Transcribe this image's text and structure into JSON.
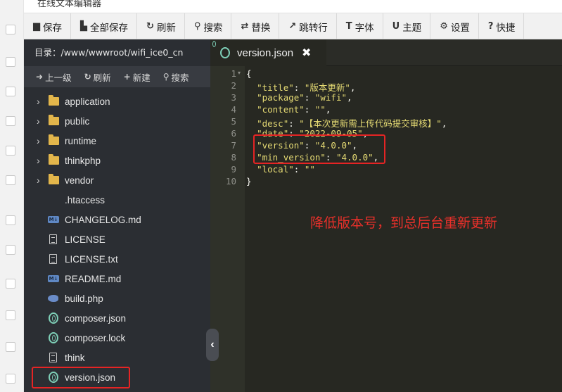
{
  "window": {
    "title": "在线文本编辑器"
  },
  "toolbar": {
    "items": [
      {
        "label": "保存",
        "icon": "save-icon"
      },
      {
        "label": "全部保存",
        "icon": "save-all-icon"
      },
      {
        "label": "刷新",
        "icon": "refresh-icon"
      },
      {
        "label": "搜索",
        "icon": "search-icon"
      },
      {
        "label": "替换",
        "icon": "replace-icon"
      },
      {
        "label": "跳转行",
        "icon": "goto-line-icon"
      },
      {
        "label": "字体",
        "icon": "font-icon"
      },
      {
        "label": "主题",
        "icon": "theme-icon"
      },
      {
        "label": "设置",
        "icon": "gear-icon"
      },
      {
        "label": "快捷",
        "icon": "help-icon"
      }
    ]
  },
  "sidebar": {
    "path_label": "目录：/www/wwwroot/wifi_ice0_cn",
    "tools": [
      {
        "label": "上一级",
        "icon": "up-level-icon"
      },
      {
        "label": "刷新",
        "icon": "refresh-icon"
      },
      {
        "label": "新建",
        "icon": "plus-icon"
      },
      {
        "label": "搜索",
        "icon": "search-icon"
      }
    ],
    "tree": [
      {
        "name": "application",
        "type": "folder"
      },
      {
        "name": "public",
        "type": "folder"
      },
      {
        "name": "runtime",
        "type": "folder"
      },
      {
        "name": "thinkphp",
        "type": "folder"
      },
      {
        "name": "vendor",
        "type": "folder"
      },
      {
        "name": ".htaccess",
        "type": "file"
      },
      {
        "name": "CHANGELOG.md",
        "type": "markdown"
      },
      {
        "name": "LICENSE",
        "type": "text"
      },
      {
        "name": "LICENSE.txt",
        "type": "text"
      },
      {
        "name": "README.md",
        "type": "markdown"
      },
      {
        "name": "build.php",
        "type": "php"
      },
      {
        "name": "composer.json",
        "type": "json"
      },
      {
        "name": "composer.lock",
        "type": "json"
      },
      {
        "name": "think",
        "type": "text"
      },
      {
        "name": "version.json",
        "type": "json",
        "selected": true
      }
    ]
  },
  "editor": {
    "tab": {
      "filename": "version.json",
      "close": "✖"
    },
    "lines": [
      {
        "n": "1",
        "text": "{"
      },
      {
        "n": "2",
        "key": "\"title\"",
        "val": "\"版本更新\"",
        "end": ","
      },
      {
        "n": "3",
        "key": "\"package\"",
        "val": "\"wifi\"",
        "end": ","
      },
      {
        "n": "4",
        "key": "\"content\"",
        "val": "\"\"",
        "end": ","
      },
      {
        "n": "5",
        "key": "\"desc\"",
        "val": "\"【本次更新需上传代码提交审核】\"",
        "end": ","
      },
      {
        "n": "6",
        "key": "\"date\"",
        "val": "\"2022-09-05\"",
        "end": ","
      },
      {
        "n": "7",
        "key": "\"version\"",
        "val": "\"4.0.0\"",
        "end": ","
      },
      {
        "n": "8",
        "key": "\"min_version\"",
        "val": "\"4.0.0\"",
        "end": ","
      },
      {
        "n": "9",
        "key": "\"local\"",
        "val": "\"\"",
        "end": ""
      },
      {
        "n": "10",
        "text": "}"
      }
    ]
  },
  "annotation": {
    "note": "降低版本号，到总后台重新更新",
    "color": "#e52424"
  }
}
